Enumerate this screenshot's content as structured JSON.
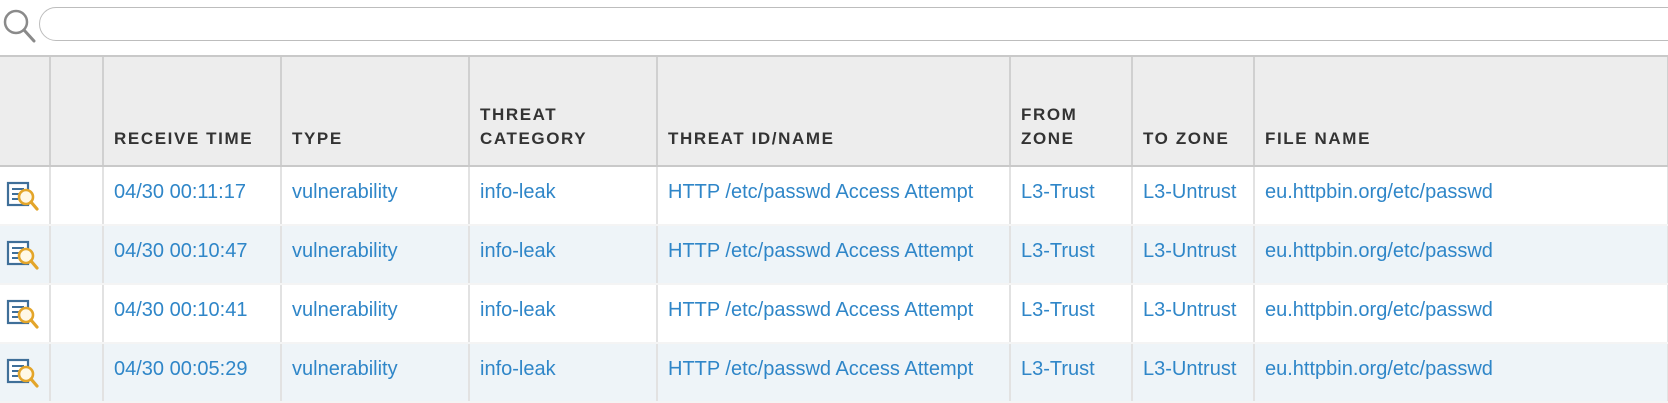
{
  "search": {
    "value": "",
    "placeholder": ""
  },
  "columns": [
    {
      "key": "detail",
      "label": ""
    },
    {
      "key": "blank",
      "label": ""
    },
    {
      "key": "receive_time",
      "label": "RECEIVE TIME"
    },
    {
      "key": "type",
      "label": "TYPE"
    },
    {
      "key": "threat_category",
      "label": "THREAT CATEGORY"
    },
    {
      "key": "threat_id_name",
      "label": "THREAT ID/NAME"
    },
    {
      "key": "from_zone",
      "label": "FROM ZONE"
    },
    {
      "key": "to_zone",
      "label": "TO ZONE"
    },
    {
      "key": "file_name",
      "label": "FILE NAME"
    }
  ],
  "rows": [
    {
      "receive_time": "04/30 00:11:17",
      "type": "vulnerability",
      "threat_category": "info-leak",
      "threat_id_name": "HTTP /etc/passwd Access Attempt",
      "from_zone": "L3-Trust",
      "to_zone": "L3-Untrust",
      "file_name": "eu.httpbin.org/etc/passwd"
    },
    {
      "receive_time": "04/30 00:10:47",
      "type": "vulnerability",
      "threat_category": "info-leak",
      "threat_id_name": "HTTP /etc/passwd Access Attempt",
      "from_zone": "L3-Trust",
      "to_zone": "L3-Untrust",
      "file_name": "eu.httpbin.org/etc/passwd"
    },
    {
      "receive_time": "04/30 00:10:41",
      "type": "vulnerability",
      "threat_category": "info-leak",
      "threat_id_name": "HTTP /etc/passwd Access Attempt",
      "from_zone": "L3-Trust",
      "to_zone": "L3-Untrust",
      "file_name": "eu.httpbin.org/etc/passwd"
    },
    {
      "receive_time": "04/30 00:05:29",
      "type": "vulnerability",
      "threat_category": "info-leak",
      "threat_id_name": "HTTP /etc/passwd Access Attempt",
      "from_zone": "L3-Trust",
      "to_zone": "L3-Untrust",
      "file_name": "eu.httpbin.org/etc/passwd"
    }
  ],
  "icons": {
    "search": "search-icon",
    "row_detail": "log-detail-icon"
  },
  "colors": {
    "link": "#2f86c8",
    "header_bg": "#ededed",
    "alt_row_bg": "#eef4f8"
  }
}
